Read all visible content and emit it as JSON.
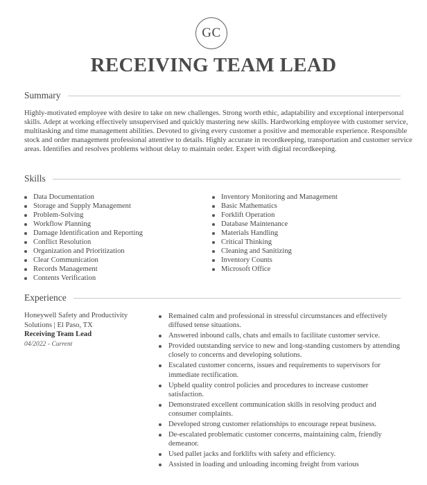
{
  "header": {
    "initials": "GC",
    "job_title": "RECEIVING TEAM LEAD"
  },
  "summary": {
    "heading": "Summary",
    "text": "Highly-motivated employee with desire to take on new challenges. Strong worth ethic, adaptability and exceptional interpersonal skills. Adept at working effectively unsupervised and quickly mastering new skills. Hardworking employee with customer service, multitasking and time management abilities. Devoted to giving every customer a positive and memorable experience. Responsible stock and order management professional attentive to details. Highly accurate in recordkeeping, transportation and customer service areas. Identifies and resolves problems without delay to maintain order. Expert with digital recordkeeping."
  },
  "skills": {
    "heading": "Skills",
    "left": [
      "Data Documentation",
      "Storage and Supply Management",
      "Problem-Solving",
      "Workflow Planning",
      "Damage Identification and Reporting",
      "Conflict Resolution",
      "Organization and Prioritization",
      "Clear Communication",
      "Records Management",
      "Contents Verification"
    ],
    "right": [
      "Inventory Monitoring and Management",
      "Basic Mathematics",
      "Forklift Operation",
      "Database Maintenance",
      "Materials Handling",
      "Critical Thinking",
      "Cleaning and Sanitizing",
      "Inventory Counts",
      "Microsoft Office"
    ]
  },
  "experience": {
    "heading": "Experience",
    "jobs": [
      {
        "company": "Honeywell Safety and Productivity Solutions | El Paso, TX",
        "title": "Receiving Team Lead",
        "dates": "04/2022 - Current",
        "bullets": [
          "Remained calm and professional in stressful circumstances and effectively diffused tense situations.",
          "Answered inbound calls, chats and emails to facilitate customer service.",
          "Provided outstanding service to new and long-standing customers by attending closely to concerns and developing solutions.",
          "Escalated customer concerns, issues and requirements to supervisors for immediate rectification.",
          "Upheld quality control policies and procedures to increase customer satisfaction.",
          "Demonstrated excellent communication skills in resolving product and consumer complaints.",
          "Developed strong customer relationships to encourage repeat business.",
          "De-escalated problematic customer concerns, maintaining calm, friendly demeanor.",
          "Used pallet jacks and forklifts with safety and efficiency.",
          "Assisted in loading and unloading incoming freight from various"
        ]
      }
    ]
  }
}
